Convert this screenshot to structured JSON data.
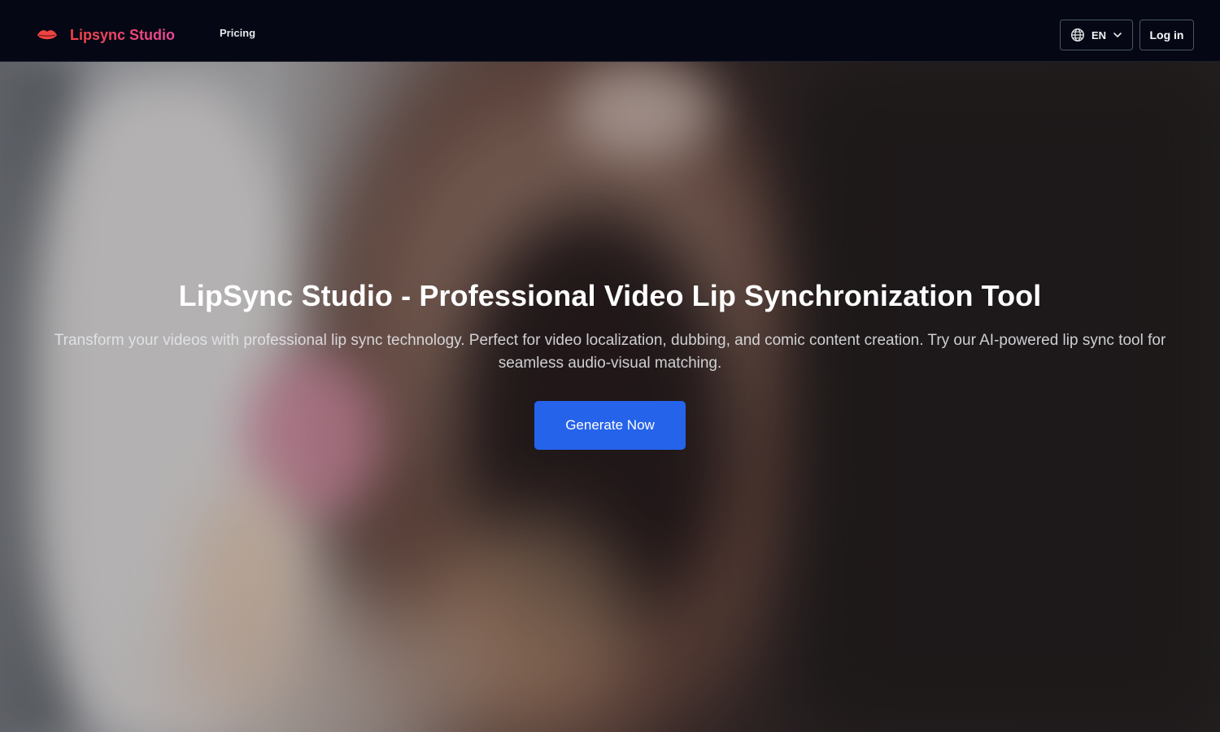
{
  "nav": {
    "brand": "Lipsync Studio",
    "brand_icon": "lips-icon",
    "links": [
      {
        "label": "Pricing"
      }
    ],
    "language": {
      "label": "EN",
      "icon": "globe-icon",
      "caret_icon": "chevron-down-icon"
    },
    "login_label": "Log in"
  },
  "hero": {
    "title": "LipSync Studio - Professional Video Lip Synchronization Tool",
    "subtitle": "Transform your videos with professional lip sync technology. Perfect for video localization, dubbing, and comic content creation. Try our AI-powered lip sync tool for seamless audio-visual matching.",
    "cta_label": "Generate Now"
  },
  "colors": {
    "nav_background": "#050814",
    "brand_gradient_start": "#ef4444",
    "brand_gradient_end": "#ec4899",
    "cta_background": "#2563eb",
    "title_text": "#ffffff"
  }
}
